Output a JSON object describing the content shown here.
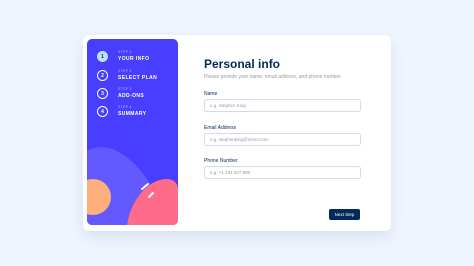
{
  "sidebar": {
    "steps": [
      {
        "number": "1",
        "label": "STEP 1",
        "title": "YOUR INFO",
        "active": true
      },
      {
        "number": "2",
        "label": "STEP 2",
        "title": "SELECT PLAN",
        "active": false
      },
      {
        "number": "3",
        "label": "STEP 3",
        "title": "ADD-ONS",
        "active": false
      },
      {
        "number": "4",
        "label": "STEP 4",
        "title": "SUMMARY",
        "active": false
      }
    ],
    "colors": {
      "background": "#483eff",
      "active_step": "#bee2fd",
      "blob_pink": "#ff6b8a",
      "blob_orange": "#ffaf7e",
      "blob_purple": "#6259ff"
    }
  },
  "form": {
    "title": "Personal info",
    "subtitle": "Please provide your name, email address, and phone number.",
    "fields": [
      {
        "label": "Name",
        "placeholder": "e.g. Stephen King"
      },
      {
        "label": "Email Address",
        "placeholder": "e.g. stephenking@lorem.com"
      },
      {
        "label": "Phone Number",
        "placeholder": "e.g. +1 234 567 890"
      }
    ],
    "next_label": "Next Step"
  },
  "colors": {
    "page_bg": "#eef5ff",
    "marine_blue": "#02295a",
    "border": "#d6d9e6",
    "cool_gray": "#9699ab"
  }
}
